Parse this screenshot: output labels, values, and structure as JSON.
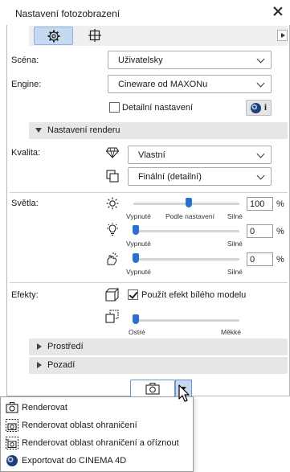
{
  "window": {
    "title": "Nastavení fotozobrazení"
  },
  "tabs": [
    {
      "icon": "gear-icon",
      "active": true
    },
    {
      "icon": "crop-frame-icon",
      "active": false
    }
  ],
  "scene": {
    "label": "Scéna:",
    "value": "Uživatelsky"
  },
  "engine": {
    "label": "Engine:",
    "value": "Cineware od MAXONu"
  },
  "detailed": {
    "label": "Detailní nastavení",
    "checked": false
  },
  "render_settings": {
    "title": "Nastavení renderu"
  },
  "quality": {
    "label": "Kvalita:",
    "preset": "Vlastní",
    "mode": "Finální (detailní)"
  },
  "lights": {
    "label": "Světla:",
    "sliders": [
      {
        "icon": "sun-icon",
        "value": "100",
        "unit": "%",
        "left": "Vypnuté",
        "mid": "Podle nastavení",
        "right": "Silné",
        "level": 0.5
      },
      {
        "icon": "bulb-icon",
        "value": "0",
        "unit": "%",
        "left": "Vypnuté",
        "mid": "",
        "right": "Silné",
        "level": 0.0
      },
      {
        "icon": "hand-light-icon",
        "value": "0",
        "unit": "%",
        "left": "Vypnuté",
        "mid": "",
        "right": "Silné",
        "level": 0.0
      }
    ]
  },
  "effects": {
    "label": "Efekty:",
    "white_model": {
      "label": "Použít efekt bílého modelu",
      "checked": true
    },
    "sharpness": {
      "left": "Ostré",
      "right": "Měkké",
      "level": 0.0
    }
  },
  "sections": [
    {
      "title": "Prostředí"
    },
    {
      "title": "Pozadí"
    }
  ],
  "menu": {
    "items": [
      {
        "label": "Renderovat",
        "icon": "camera-icon"
      },
      {
        "label": "Renderovat oblast ohraničení",
        "icon": "camera-area-icon"
      },
      {
        "label": "Renderovat oblast ohraničení a oříznout",
        "icon": "camera-crop-icon"
      },
      {
        "label": "Exportovat do CINEMA 4D",
        "icon": "cinema4d-icon"
      }
    ]
  },
  "colors": {
    "accent": "#2a6fd1",
    "tab_active": "#c5d9f1",
    "section_bg": "#e6e6e6"
  }
}
